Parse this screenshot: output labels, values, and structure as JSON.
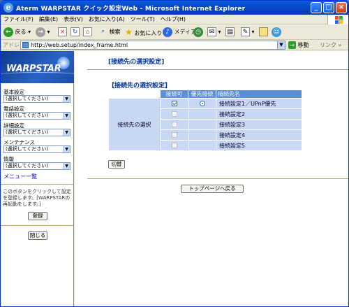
{
  "window": {
    "title": "Aterm WARPSTAR クイック設定Web - Microsoft Internet Explorer",
    "minimize": "_",
    "maximize": "□",
    "close": "×"
  },
  "menu": [
    "ファイル(F)",
    "編集(E)",
    "表示(V)",
    "お気に入り(A)",
    "ツール(T)",
    "ヘルプ(H)"
  ],
  "toolbar": {
    "back": "戻る",
    "search": "検索",
    "favorites": "お気に入り",
    "media": "メディア"
  },
  "address": {
    "label": "アドレス(D)",
    "url": "http://web.setup/index_frame.html",
    "go": "移動",
    "links": "リンク »"
  },
  "sidebar": {
    "logo": "WARPSTAR",
    "groups": [
      {
        "label": "基本設定",
        "value": "(選択してください)"
      },
      {
        "label": "電話設定",
        "value": "(選択してください)"
      },
      {
        "label": "詳細設定",
        "value": "(選択してください)"
      },
      {
        "label": "メンテナンス",
        "value": "(選択してください)"
      },
      {
        "label": "情報",
        "value": "(選択してください)"
      }
    ],
    "menu_list": "メニュー一覧",
    "note": "このボタンをクリックして設定を登録します。[WARPSTARの再起動をします。]",
    "register": "登録",
    "close": "閉じる"
  },
  "main": {
    "page_title": "[接続先の選択設定]",
    "section_title": "【接続先の選択設定】",
    "columns": [
      "接続可",
      "優先接続",
      "接続先名"
    ],
    "row_header": "接続先の選択",
    "rows": [
      {
        "name": "接続設定1／UPnP優先",
        "enabled": true,
        "priority": true,
        "active": true
      },
      {
        "name": "接続設定2",
        "enabled": false,
        "priority": false,
        "active": false
      },
      {
        "name": "接続設定3",
        "enabled": false,
        "priority": false,
        "active": false
      },
      {
        "name": "接続設定4",
        "enabled": false,
        "priority": false,
        "active": false
      },
      {
        "name": "接続設定5",
        "enabled": false,
        "priority": false,
        "active": false
      }
    ],
    "switch_button": "切替",
    "top_button": "トップページへ戻る"
  },
  "colors": {
    "titlebar": "#0a5fe0",
    "header_blue": "#5b8fd8",
    "cell_blue": "#c8d8f2",
    "heading": "#003399"
  }
}
